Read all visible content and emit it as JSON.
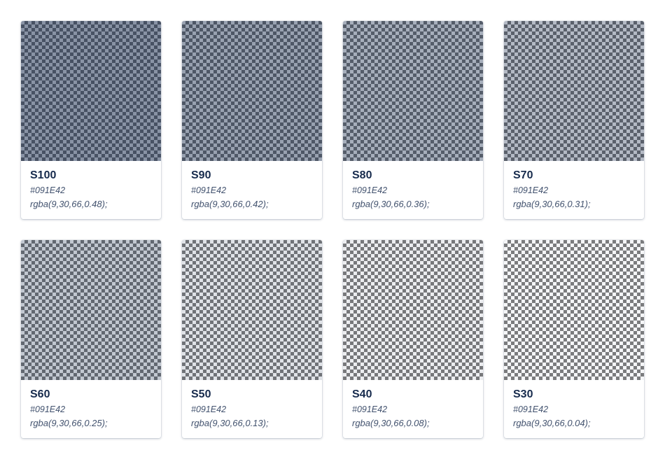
{
  "swatches": [
    {
      "name": "S100",
      "hex": "#091E42",
      "rgba": "rgba(9,30,66,0.48);",
      "alpha": 0.48
    },
    {
      "name": "S90",
      "hex": "#091E42",
      "rgba": "rgba(9,30,66,0.42);",
      "alpha": 0.42
    },
    {
      "name": "S80",
      "hex": "#091E42",
      "rgba": "rgba(9,30,66,0.36);",
      "alpha": 0.36
    },
    {
      "name": "S70",
      "hex": "#091E42",
      "rgba": "rgba(9,30,66,0.31);",
      "alpha": 0.31
    },
    {
      "name": "S60",
      "hex": "#091E42",
      "rgba": "rgba(9,30,66,0.25);",
      "alpha": 0.25
    },
    {
      "name": "S50",
      "hex": "#091E42",
      "rgba": "rgba(9,30,66,0.13);",
      "alpha": 0.13
    },
    {
      "name": "S40",
      "hex": "#091E42",
      "rgba": "rgba(9,30,66,0.08);",
      "alpha": 0.08
    },
    {
      "name": "S30",
      "hex": "#091E42",
      "rgba": "rgba(9,30,66,0.04);",
      "alpha": 0.04
    }
  ]
}
